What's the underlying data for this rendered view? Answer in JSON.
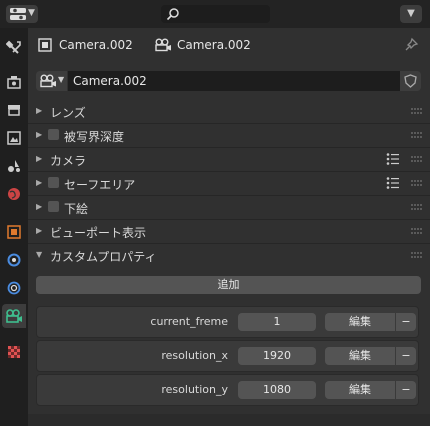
{
  "header": {
    "object_name": "Camera.002",
    "data_name": "Camera.002"
  },
  "datablock": {
    "name": "Camera.002"
  },
  "sections": [
    {
      "label": "レンズ"
    },
    {
      "label": "被写界深度"
    },
    {
      "label": "カメラ"
    },
    {
      "label": "セーフエリア"
    },
    {
      "label": "下絵"
    },
    {
      "label": "ビューポート表示"
    },
    {
      "label": "カスタムプロパティ"
    }
  ],
  "custom_props": {
    "add_label": "追加",
    "rows": [
      {
        "name": "current_freme",
        "value": "1",
        "edit_label": "編集",
        "remove_label": "−"
      },
      {
        "name": "resolution_x",
        "value": "1920",
        "edit_label": "編集",
        "remove_label": "−"
      },
      {
        "name": "resolution_y",
        "value": "1080",
        "edit_label": "編集",
        "remove_label": "−"
      }
    ]
  },
  "icons": {
    "editor": "properties-editor-icon",
    "search": "search-icon",
    "object": "object-icon",
    "camera_data": "camera-data-icon",
    "pin": "pin-icon",
    "shield": "fake-user-shield-icon"
  },
  "colors": {
    "accent_orange": "#e07a2e",
    "object_data_green": "#3fbf8f",
    "modifier_blue": "#4a8ce0",
    "world_red": "#c44"
  }
}
